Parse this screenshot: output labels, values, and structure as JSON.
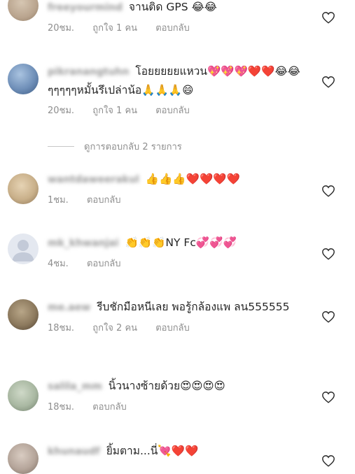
{
  "comments": [
    {
      "username": "freeyourmind",
      "text": "จานติด GPS 😂😂",
      "time": "20ชม.",
      "likes": "ถูกใจ 1 คน",
      "reply": "ตอบกลับ",
      "avatar_color": "#b9a48e"
    },
    {
      "username": "pikranangtuhn",
      "text": "โอยยยยยแหวน💖💖💖❤️❤️😂😂ๆๆๆๆๆหมั้นรึเปล่าน้อ🙏🙏🙏😄",
      "time": "20ชม.",
      "likes": "ถูกใจ 1 คน",
      "reply": "ตอบกลับ",
      "avatar_color": "#6f8fb8"
    },
    {
      "username": "wantdaweerakul",
      "text": "👍👍👍❤️❤️❤️❤️",
      "time": "1ชม.",
      "likes": "",
      "reply": "ตอบกลับ",
      "avatar_color": "#c9b08a"
    },
    {
      "username": "mk_khwanjai",
      "text": "👏👏👏NY Fc💞💞💞",
      "time": "4ชม.",
      "likes": "",
      "reply": "ตอบกลับ",
      "avatar_color": "#d8dce6"
    },
    {
      "username": "me.aew",
      "text": "รีบชักมือหนีเลย  พอรู้กล้องแพ ลน555555",
      "time": "18ชม.",
      "likes": "ถูกใจ 2 คน",
      "reply": "ตอบกลับ",
      "avatar_color": "#8d7a5e"
    },
    {
      "username": "salila_mm",
      "text": "นิ้วนางซ้ายด้วย😍😍😍😍",
      "time": "18ชม.",
      "likes": "",
      "reply": "ตอบกลับ",
      "avatar_color": "#a9b8a2"
    },
    {
      "username": "khunaudf",
      "text": "ยิ้มตาม...นี่💘❤️❤️",
      "time": "",
      "likes": "",
      "reply": "",
      "avatar_color": "#b5a59a"
    }
  ],
  "view_replies": "ดูการตอบกลับ 2 รายการ",
  "colors": {
    "muted": "#8e8e8e",
    "text": "#262626",
    "heart_outline": "#262626"
  },
  "icons": {
    "like": "heart-outline-icon"
  }
}
